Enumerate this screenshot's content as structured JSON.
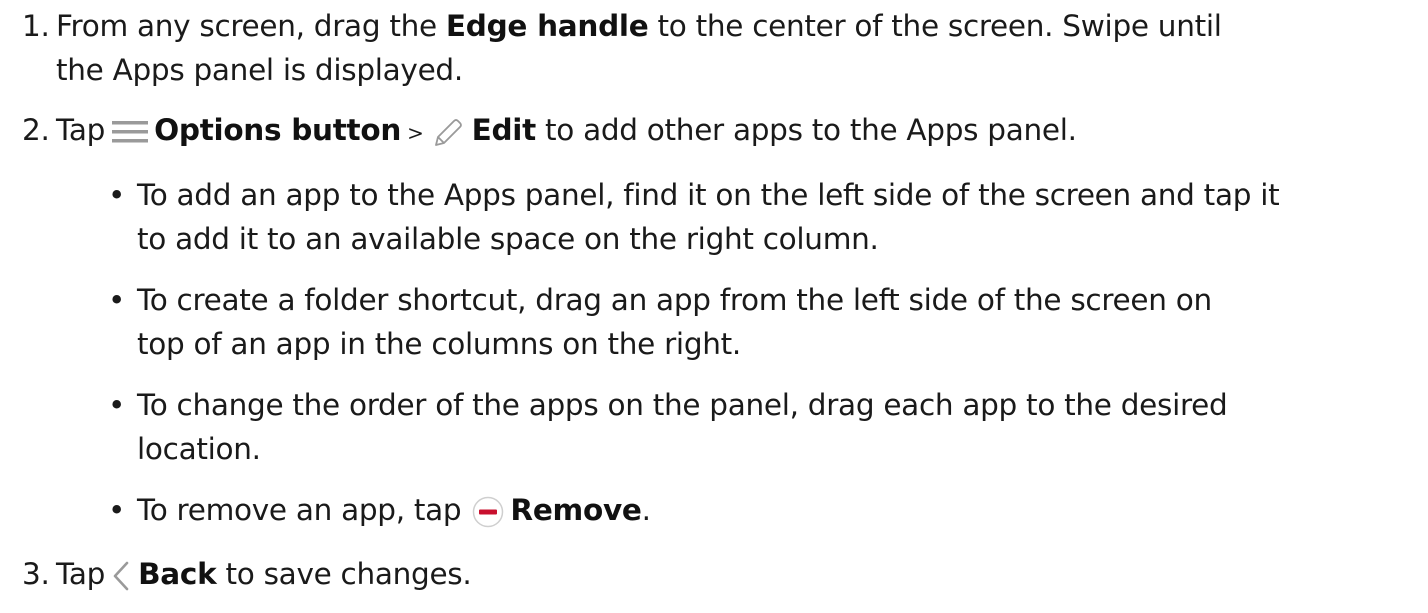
{
  "steps": [
    {
      "number": "1.",
      "line1_pre": "From any screen, drag the ",
      "line1_bold": "Edge handle",
      "line1_post": " to the center of the screen. Swipe until",
      "line2": "the Apps panel is displayed."
    },
    {
      "number": "2.",
      "pre": "Tap ",
      "options_bold": "Options button",
      "separator": " > ",
      "edit_bold": "Edit",
      "post": " to add other apps to the Apps panel."
    },
    {
      "number": "3.",
      "pre": "Tap ",
      "back_bold": "Back",
      "post": " to save changes."
    }
  ],
  "bullets": [
    {
      "marker": "•",
      "line1": "To add an app to the Apps panel, find it on the left side of the screen and tap it",
      "line2": "to add it to an available space on the right column."
    },
    {
      "marker": "•",
      "line1": "To create a folder shortcut, drag an app from the left side of the screen on",
      "line2": "top of an app in the columns on the right."
    },
    {
      "marker": "•",
      "line1": "To change the order of the apps on the panel, drag each app to the desired",
      "line2": "location."
    },
    {
      "marker": "•",
      "pre": "To remove an app, tap ",
      "bold": "Remove",
      "post": "."
    }
  ],
  "icons": {
    "options": "hamburger-menu-icon",
    "edit": "pencil-icon",
    "remove": "remove-minus-circle-icon",
    "back": "chevron-left-icon"
  },
  "colors": {
    "remove_red": "#c8102e",
    "icon_gray": "#9a9a9a"
  }
}
